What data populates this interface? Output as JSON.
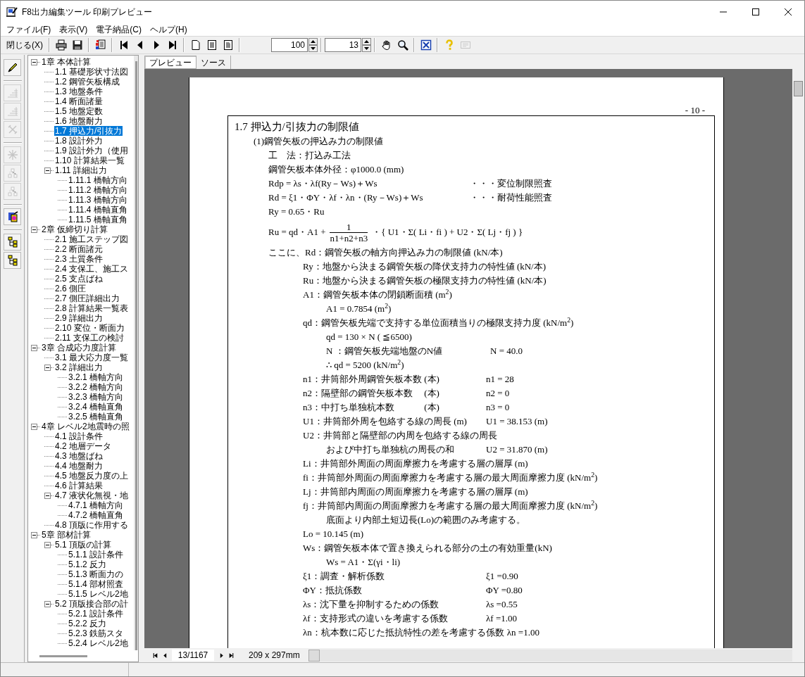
{
  "window": {
    "title": "F8出力編集ツール 印刷プレビュー"
  },
  "menu": [
    "ファイル(F)",
    "表示(V)",
    "電子納品(C)",
    "ヘルプ(H)"
  ],
  "toolbar": [
    [
      {
        "kind": "close",
        "label": "閉じる(X)"
      }
    ],
    [
      {
        "kind": "print",
        "disabled": false
      },
      {
        "kind": "save",
        "disabled": false
      }
    ],
    [
      {
        "kind": "pageset",
        "disabled": false
      }
    ],
    [
      {
        "kind": "first",
        "disabled": false
      },
      {
        "kind": "prev",
        "disabled": false
      },
      {
        "kind": "next",
        "disabled": false
      },
      {
        "kind": "last",
        "disabled": false
      }
    ],
    [
      {
        "kind": "page",
        "disabled": false
      },
      {
        "kind": "pageframe",
        "disabled": false
      },
      {
        "kind": "pagecorner",
        "disabled": false
      }
    ],
    [
      {
        "kind": "spinner",
        "value": "100"
      }
    ],
    [
      {
        "kind": "spinner",
        "value": "13"
      }
    ],
    [
      {
        "kind": "hand",
        "disabled": false
      },
      {
        "kind": "zoom",
        "disabled": false
      }
    ],
    [
      {
        "kind": "fit",
        "disabled": false
      }
    ],
    [
      {
        "kind": "help",
        "disabled": false
      },
      {
        "kind": "card",
        "disabled": true
      }
    ]
  ],
  "side_toolbar": [
    [
      {
        "kind": "pencil",
        "disabled": false
      }
    ],
    [
      {
        "kind": "stairs",
        "disabled": true
      },
      {
        "kind": "stairs",
        "disabled": true
      },
      {
        "kind": "tool",
        "disabled": true
      }
    ],
    [
      {
        "kind": "burst",
        "disabled": true
      },
      {
        "kind": "boxes",
        "disabled": true
      },
      {
        "kind": "boxes",
        "disabled": true
      }
    ],
    [
      {
        "kind": "colorful",
        "disabled": false
      }
    ],
    [
      {
        "kind": "tree",
        "disabled": false
      },
      {
        "kind": "tree",
        "disabled": false
      }
    ]
  ],
  "tree": [
    {
      "label": "1章 本体計算",
      "selected": false,
      "expanded": true,
      "children": [
        {
          "label": "1.1 基礎形状寸法図",
          "selected": false
        },
        {
          "label": "1.2 鋼管矢板構成",
          "selected": false
        },
        {
          "label": "1.3 地盤条件",
          "selected": false
        },
        {
          "label": "1.4 断面諸量",
          "selected": false
        },
        {
          "label": "1.5 地盤定数",
          "selected": false
        },
        {
          "label": "1.6 地盤耐力",
          "selected": false
        },
        {
          "label": "1.7 押込力/引抜力",
          "selected": true
        },
        {
          "label": "1.8 設計外力",
          "selected": false
        },
        {
          "label": "1.9 設計外力（使用",
          "selected": false
        },
        {
          "label": "1.10 計算結果一覧",
          "selected": false
        },
        {
          "label": "1.11 詳細出力",
          "selected": false,
          "expanded": true,
          "children": [
            {
              "label": "1.11.1 橋軸方向",
              "selected": false
            },
            {
              "label": "1.11.2 橋軸方向",
              "selected": false
            },
            {
              "label": "1.11.3 橋軸方向",
              "selected": false
            },
            {
              "label": "1.11.4 橋軸直角",
              "selected": false
            },
            {
              "label": "1.11.5 橋軸直角",
              "selected": false
            }
          ]
        }
      ]
    },
    {
      "label": "2章 仮締切り計算",
      "selected": false,
      "expanded": true,
      "children": [
        {
          "label": "2.1 施工ステップ図",
          "selected": false
        },
        {
          "label": "2.2 断面諸元",
          "selected": false
        },
        {
          "label": "2.3 土質条件",
          "selected": false
        },
        {
          "label": "2.4 支保工、施工ス",
          "selected": false
        },
        {
          "label": "2.5 支点ばね",
          "selected": false
        },
        {
          "label": "2.6 側圧",
          "selected": false
        },
        {
          "label": "2.7 側圧詳細出力",
          "selected": false
        },
        {
          "label": "2.8 計算結果一覧表",
          "selected": false
        },
        {
          "label": "2.9 詳細出力",
          "selected": false
        },
        {
          "label": "2.10 変位・断面力",
          "selected": false
        },
        {
          "label": "2.11 支保工の検討",
          "selected": false
        }
      ]
    },
    {
      "label": "3章 合成応力度計算",
      "selected": false,
      "expanded": true,
      "children": [
        {
          "label": "3.1 最大応力度一覧",
          "selected": false
        },
        {
          "label": "3.2 詳細出力",
          "selected": false,
          "expanded": true,
          "children": [
            {
              "label": "3.2.1 橋軸方向",
              "selected": false
            },
            {
              "label": "3.2.2 橋軸方向",
              "selected": false
            },
            {
              "label": "3.2.3 橋軸方向",
              "selected": false
            },
            {
              "label": "3.2.4 橋軸直角",
              "selected": false
            },
            {
              "label": "3.2.5 橋軸直角",
              "selected": false
            }
          ]
        }
      ]
    },
    {
      "label": "4章 レベル2地震時の照",
      "selected": false,
      "expanded": true,
      "children": [
        {
          "label": "4.1 設計条件",
          "selected": false
        },
        {
          "label": "4.2 地層データ",
          "selected": false
        },
        {
          "label": "4.3 地盤ばね",
          "selected": false
        },
        {
          "label": "4.4 地盤耐力",
          "selected": false
        },
        {
          "label": "4.5 地盤反力度の上",
          "selected": false
        },
        {
          "label": "4.6 計算結果",
          "selected": false
        },
        {
          "label": "4.7 液状化無視・地",
          "selected": false,
          "expanded": true,
          "children": [
            {
              "label": "4.7.1 橋軸方向",
              "selected": false
            },
            {
              "label": "4.7.2 橋軸直角",
              "selected": false
            }
          ]
        },
        {
          "label": "4.8 頂版に作用する",
          "selected": false
        }
      ]
    },
    {
      "label": "5章 部材計算",
      "selected": false,
      "expanded": true,
      "children": [
        {
          "label": "5.1 頂版の計算",
          "selected": false,
          "expanded": true,
          "children": [
            {
              "label": "5.1.1 設計条件",
              "selected": false
            },
            {
              "label": "5.1.2 反力",
              "selected": false
            },
            {
              "label": "5.1.3 断面力の",
              "selected": false
            },
            {
              "label": "5.1.4 部材照査",
              "selected": false
            },
            {
              "label": "5.1.5 レベル2地",
              "selected": false
            }
          ]
        },
        {
          "label": "5.2 頂版接合部の計",
          "selected": false,
          "expanded": true,
          "children": [
            {
              "label": "5.2.1 設計条件",
              "selected": false
            },
            {
              "label": "5.2.2 反力",
              "selected": false
            },
            {
              "label": "5.2.3 鉄筋スタ",
              "selected": false
            },
            {
              "label": "5.2.4 レベル2地",
              "selected": false
            }
          ]
        }
      ]
    }
  ],
  "view_tabs": [
    {
      "label": "プレビュー",
      "selected": true
    },
    {
      "label": "ソース",
      "selected": false
    }
  ],
  "document": {
    "page_number": "- 10 -",
    "lines": [
      {
        "kind": "title",
        "text": "1.7 押込力/引抜力の制限値"
      },
      {
        "kind": "section",
        "text": "(1)鋼管矢板の押込み力の制限値"
      },
      {
        "kind": "text",
        "text": "工　法：打込み工法"
      },
      {
        "kind": "text",
        "text": "鋼管矢板本体外径：φ1000.0 (mm)"
      },
      {
        "kind": "text",
        "text": "Rdp = λs・λf(Ry－Ws)＋Ws",
        "note": "・・・変位制限照査"
      },
      {
        "kind": "text",
        "text": "Rd  = ξ1・ΦY・λf・λn・(Ry－Ws)＋Ws",
        "note": "・・・耐荷性能照査"
      },
      {
        "kind": "text",
        "text": "Ry  = 0.65・Ru"
      },
      {
        "kind": "fraction",
        "lhs": "Ru  = qd・A1 +",
        "numerator": "1",
        "denominator": "n1+n2+n3",
        "rhs": "・{ U1・Σ( Li・fi ) + U2・Σ( Lj・fj ) }"
      },
      {
        "kind": "text",
        "text": "ここに、Rd：鋼管矢板の軸方向押込み力の制限値 (kN/本)"
      },
      {
        "kind": "def",
        "text": "Ry：地盤から決まる鋼管矢板の降伏支持力の特性値 (kN/本)"
      },
      {
        "kind": "def",
        "text": "Ru：地盤から決まる鋼管矢板の極限支持力の特性値 (kN/本)"
      },
      {
        "kind": "def",
        "text": "A1：鋼管矢板本体の閉鎖断面積 (m$^{2}$)"
      },
      {
        "kind": "sub",
        "text": "A1 = 0.7854 (m$^{2}$)"
      },
      {
        "kind": "def",
        "text": "qd：鋼管矢板先端で支持する単位面積当りの極限支持力度 (kN/m$^{2}$)"
      },
      {
        "kind": "sub",
        "text": "qd = 130 × N ( ≦6500)"
      },
      {
        "kind": "sub",
        "text": "N ：鋼管矢板先端地盤のN値",
        "value": "N =  40.0"
      },
      {
        "kind": "sub",
        "text": "∴ qd = 5200 (kN/m$^{2}$)"
      },
      {
        "kind": "def",
        "text": "n1：井筒部外周鋼管矢板本数 (本)",
        "value": "n1 =  28"
      },
      {
        "kind": "def",
        "text": "n2：隔壁部の鋼管矢板本数　 (本)",
        "value": "n2 =   0"
      },
      {
        "kind": "def",
        "text": "n3：中打ち単独杭本数　　　 (本)",
        "value": "n3 =   0"
      },
      {
        "kind": "def",
        "text": "U1：井筒部外周を包絡する線の周長 (m)",
        "value": "U1 =  38.153 (m)"
      },
      {
        "kind": "def",
        "text": "U2：井筒部と隔壁部の内周を包絡する線の周長"
      },
      {
        "kind": "cont",
        "text": "および中打ち単独杭の周長の和",
        "value": "U2 =  31.870 (m)"
      },
      {
        "kind": "def",
        "text": "Li：井筒部外周面の周面摩擦力を考慮する層の層厚 (m)"
      },
      {
        "kind": "def",
        "text": "fi：井筒部外周面の周面摩擦力を考慮する層の最大周面摩擦力度 (kN/m$^{2}$)"
      },
      {
        "kind": "def",
        "text": "Lj：井筒部内周面の周面摩擦力を考慮する層の層厚 (m)"
      },
      {
        "kind": "def",
        "text": "fj：井筒部内周面の周面摩擦力を考慮する層の最大周面摩擦力度 (kN/m$^{2}$)"
      },
      {
        "kind": "cont",
        "text": "底面より内部土短辺長(Lo)の範囲のみ考慮する。"
      },
      {
        "kind": "def",
        "text": "Lo = 10.145 (m)"
      },
      {
        "kind": "def",
        "text": "Ws：鋼管矢板本体で置き換えられる部分の土の有効重量(kN)"
      },
      {
        "kind": "sub",
        "text": "Ws = A1・Σ(γi・li)"
      },
      {
        "kind": "def",
        "text": "ξ1：調査・解析係数",
        "value": "ξ1 =0.90"
      },
      {
        "kind": "def",
        "text": "ΦY：抵抗係数",
        "value": "ΦY =0.80"
      },
      {
        "kind": "def",
        "text": "λs：沈下量を抑制するための係数",
        "value": "λs =0.55"
      },
      {
        "kind": "def",
        "text": "λf：支持形式の違いを考慮する係数",
        "value": "λf =1.00"
      },
      {
        "kind": "def",
        "text": "λn：杭本数に応じた抵抗特性の差を考慮する係数",
        "value": "λn =1.00"
      }
    ]
  },
  "page_nav": {
    "page_field": "13/1167",
    "paper_size": "209 x 297mm"
  }
}
